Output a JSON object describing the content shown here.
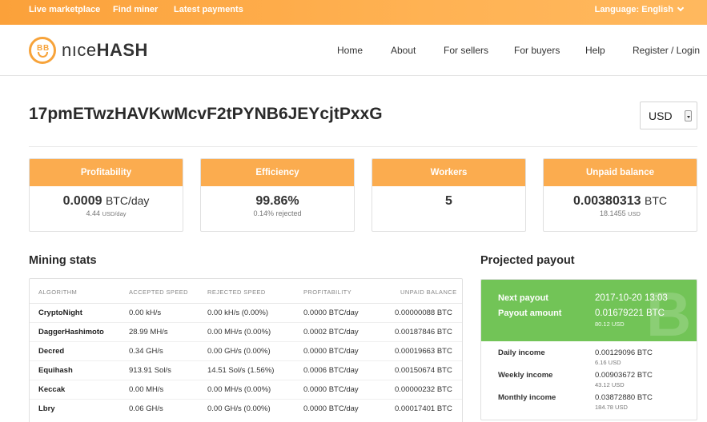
{
  "topbar": {
    "links": [
      "Live marketplace",
      "Find miner",
      "Latest payments"
    ],
    "language": "Language: English"
  },
  "logo": {
    "part1": "nıce",
    "part2": "HASH"
  },
  "nav": [
    "Home",
    "About",
    "For sellers",
    "For buyers",
    "Help",
    "Register / Login"
  ],
  "address": "17pmETwzHAVKwMcvF2tPYNB6JEYcjtPxxG",
  "currency": "USD",
  "cards": [
    {
      "title": "Profitability",
      "value": "0.0009",
      "unit": "BTC/day",
      "sub_value": "4.44",
      "sub_unit": "USD/day"
    },
    {
      "title": "Efficiency",
      "value": "99.86%",
      "unit": "",
      "sub_value": "0.14% rejected",
      "sub_unit": ""
    },
    {
      "title": "Workers",
      "value": "5",
      "unit": "",
      "sub_value": "",
      "sub_unit": ""
    },
    {
      "title": "Unpaid balance",
      "value": "0.00380313",
      "unit": "BTC",
      "sub_value": "18.1455",
      "sub_unit": "USD"
    }
  ],
  "mining_stats": {
    "title": "Mining stats",
    "headers": [
      "ALGORITHM",
      "ACCEPTED SPEED",
      "REJECTED SPEED",
      "PROFITABILITY",
      "UNPAID BALANCE"
    ],
    "rows": [
      [
        "CryptoNight",
        "0.00 kH/s",
        "0.00 kH/s (0.00%)",
        "0.0000 BTC/day",
        "0.00000088 BTC"
      ],
      [
        "DaggerHashimoto",
        "28.99 MH/s",
        "0.00 MH/s (0.00%)",
        "0.0002 BTC/day",
        "0.00187846 BTC"
      ],
      [
        "Decred",
        "0.34 GH/s",
        "0.00 GH/s (0.00%)",
        "0.0000 BTC/day",
        "0.00019663 BTC"
      ],
      [
        "Equihash",
        "913.91 Sol/s",
        "14.51 Sol/s (1.56%)",
        "0.0006 BTC/day",
        "0.00150674 BTC"
      ],
      [
        "Keccak",
        "0.00 MH/s",
        "0.00 MH/s (0.00%)",
        "0.0000 BTC/day",
        "0.00000232 BTC"
      ],
      [
        "Lbry",
        "0.06 GH/s",
        "0.00 GH/s (0.00%)",
        "0.0000 BTC/day",
        "0.00017401 BTC"
      ]
    ]
  },
  "projected_payout": {
    "title": "Projected payout",
    "next_payout_label": "Next payout",
    "next_payout_value": "2017-10-20 13:03",
    "payout_amount_label": "Payout amount",
    "payout_amount_value": "0.01679221 BTC",
    "payout_amount_usd": "80.12 USD",
    "income": [
      {
        "label": "Daily income",
        "btc": "0.00129096 BTC",
        "usd": "6.16 USD"
      },
      {
        "label": "Weekly income",
        "btc": "0.00903672 BTC",
        "usd": "43.12 USD"
      },
      {
        "label": "Monthly income",
        "btc": "0.03872880 BTC",
        "usd": "184.78 USD"
      }
    ]
  },
  "colors": {
    "accent": "#fbac4f",
    "green": "#72c457"
  },
  "icons": {
    "logo": "smiley-face-icon",
    "language": "chevron-down-icon",
    "watermark": "bitcoin-icon"
  }
}
